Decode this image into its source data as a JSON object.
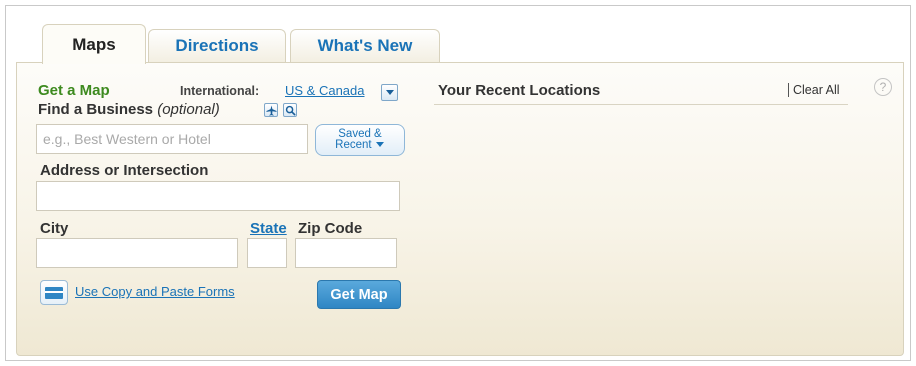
{
  "tabs": [
    {
      "label": "Maps"
    },
    {
      "label": "Directions"
    },
    {
      "label": "What's New"
    }
  ],
  "form": {
    "heading": "Get a Map",
    "international_label": "International:",
    "country_value": "US & Canada",
    "business_label": "Find a Business",
    "business_optional": "(optional)",
    "business_placeholder": "e.g., Best Western or Hotel",
    "saved_line1": "Saved &",
    "saved_line2": "Recent",
    "address_label": "Address or Intersection",
    "city_label": "City",
    "state_label": "State",
    "zip_label": "Zip Code",
    "copy_paste_link": "Use Copy and Paste Forms",
    "submit_label": "Get Map"
  },
  "recent": {
    "title": "Your Recent Locations",
    "clear_all": "Clear All",
    "help": "?"
  },
  "colors": {
    "link_blue": "#1a73b7",
    "heading_green": "#3d8a1f",
    "button_blue": "#3a8fcb"
  }
}
